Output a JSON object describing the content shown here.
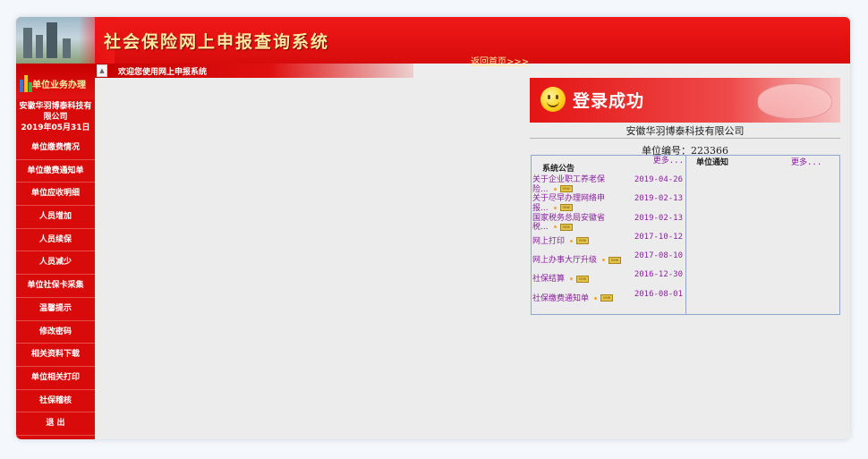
{
  "banner": {
    "title": "社会保险网上申报查询系统",
    "home_link": "返回首页>>>"
  },
  "sidebar": {
    "section_title": "单位业务办理",
    "company_line1": "安徽华羽博泰科技有",
    "company_line2": "限公司",
    "date": "2019年05月31日",
    "items": [
      {
        "label": "单位缴费情况"
      },
      {
        "label": "单位缴费通知单"
      },
      {
        "label": "单位应收明细"
      },
      {
        "label": "人员增加"
      },
      {
        "label": "人员续保"
      },
      {
        "label": "人员减少"
      },
      {
        "label": "单位社保卡采集"
      },
      {
        "label": "温馨提示"
      },
      {
        "label": "修改密码"
      },
      {
        "label": "相关资料下载"
      },
      {
        "label": "单位相关打印"
      },
      {
        "label": "社保稽核"
      },
      {
        "label": "退 出"
      }
    ]
  },
  "topbar": {
    "welcome": "欢迎您使用网上申报系统"
  },
  "login": {
    "title": "登录成功",
    "company_name": "安徽华羽博泰科技有限公司",
    "unit_no_label": "单位编号：223366"
  },
  "announcements": {
    "header": "系统公告",
    "more_label": "更多...",
    "items": [
      {
        "title": "关于企业职工养老保险...",
        "date": "2019-04-26"
      },
      {
        "title": "关于尽早办理网络申报...",
        "date": "2019-02-13"
      },
      {
        "title": "国家税务总局安徽省税...",
        "date": "2019-02-13"
      },
      {
        "title": "网上打印",
        "date": "2017-10-12"
      },
      {
        "title": "网上办事大厅升级",
        "date": "2017-08-10"
      },
      {
        "title": "社保结算",
        "date": "2016-12-30"
      },
      {
        "title": "社保缴费通知单",
        "date": "2016-08-01"
      }
    ],
    "badge_label": "new"
  },
  "notices": {
    "header": "单位通知",
    "more_label": "更多..."
  },
  "colors": {
    "primary_red": "#d90a0a",
    "title_yellow": "#ffe9a0",
    "link_purple": "#8a1fa0",
    "panel_border": "#8fa6cf"
  }
}
